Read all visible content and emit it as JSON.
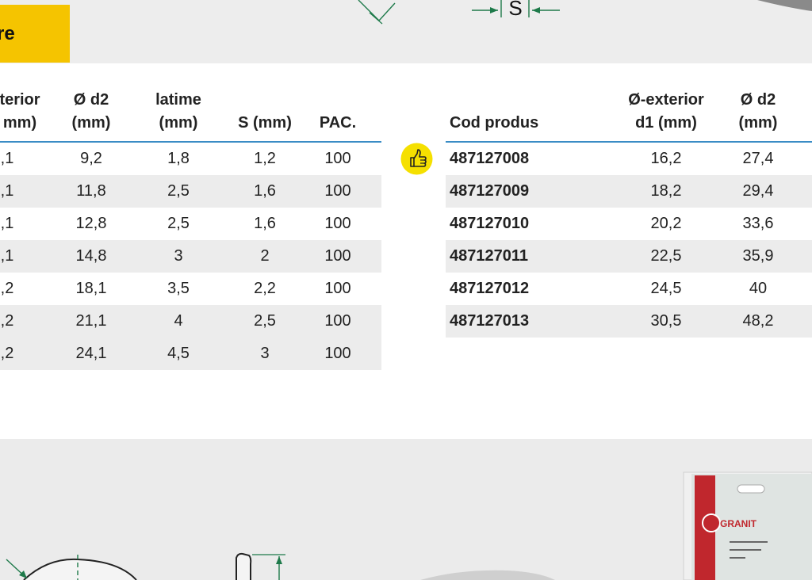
{
  "section": {
    "title": "re"
  },
  "drawing": {
    "dimension_label": "S"
  },
  "left_table": {
    "headers": [
      "terior\nmm)",
      "Ø d2\n(mm)",
      "latime\n(mm)",
      "S (mm)",
      "PAC."
    ],
    "rows": [
      [
        ",1",
        "9,2",
        "1,8",
        "1,2",
        "100"
      ],
      [
        ",1",
        "11,8",
        "2,5",
        "1,6",
        "100"
      ],
      [
        ",1",
        "12,8",
        "2,5",
        "1,6",
        "100"
      ],
      [
        ",1",
        "14,8",
        "3",
        "2",
        "100"
      ],
      [
        ",2",
        "18,1",
        "3,5",
        "2,2",
        "100"
      ],
      [
        ",2",
        "21,1",
        "4",
        "2,5",
        "100"
      ],
      [
        ",2",
        "24,1",
        "4,5",
        "3",
        "100"
      ]
    ]
  },
  "right_table": {
    "headers": [
      "Cod produs",
      "Ø-exterior\nd1 (mm)",
      "Ø d2\n(mm)"
    ],
    "rows": [
      [
        "487127008",
        "16,2",
        "27,4"
      ],
      [
        "487127009",
        "18,2",
        "29,4"
      ],
      [
        "487127010",
        "20,2",
        "33,6"
      ],
      [
        "487127011",
        "22,5",
        "35,9"
      ],
      [
        "487127012",
        "24,5",
        "40"
      ],
      [
        "487127013",
        "30,5",
        "48,2"
      ]
    ]
  },
  "recommended_icon": "thumbs-up-icon",
  "package": {
    "brand": "GRANIT"
  },
  "colors": {
    "accent_yellow": "#f5c400",
    "header_rule_blue": "#3a8cc5",
    "drawing_green": "#1e7a4a",
    "package_red": "#c0272d"
  }
}
